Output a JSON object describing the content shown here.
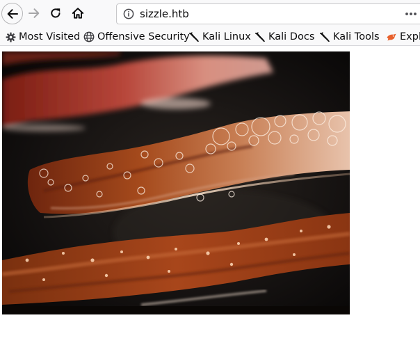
{
  "toolbar": {
    "url": "sizzle.htb"
  },
  "bookmarks": [
    {
      "label": "Most Visited",
      "icon": "gear-icon"
    },
    {
      "label": "Offensive Security",
      "icon": "globe-icon"
    },
    {
      "label": "Kali Linux",
      "icon": "kali-dragon-icon"
    },
    {
      "label": "Kali Docs",
      "icon": "kali-dragon-icon"
    },
    {
      "label": "Kali Tools",
      "icon": "kali-dragon-icon"
    },
    {
      "label": "Expl",
      "icon": "exploit-db-icon"
    }
  ],
  "page": {
    "image_alt": "bacon-icon",
    "accent": "#d9602a"
  }
}
